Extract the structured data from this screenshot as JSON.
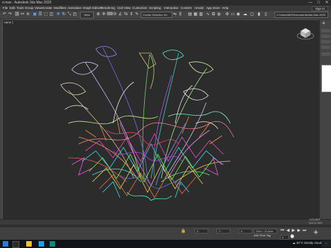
{
  "window": {
    "title": "ıt.max - Autodesk 3ds Max 2020",
    "controls": [
      "—",
      "□",
      "✕"
    ]
  },
  "menu": {
    "items": [
      "File",
      "Edit",
      "Tools",
      "Group",
      "Views",
      "Create",
      "Modifiers",
      "Animation",
      "Graph Editors",
      "Rendering",
      "Civil View",
      "Customize",
      "Scripting",
      "Interactive",
      "Content",
      "Arnold",
      "App Store",
      "Help"
    ],
    "sign_in": "Sign In"
  },
  "toolbar": {
    "view_dropdown": "View",
    "selection_set": "Create Selection Se",
    "path": "C:\\Users\\WH\\Documents\\3ds Max 2020"
  },
  "viewport": {
    "label": "[+] [Perspective] [Standard] [Wireframe]",
    "shown_label": "rame ]"
  },
  "timeline": {
    "position": "0 / 100"
  },
  "status": {
    "x_field": "X:",
    "y_field": "Y:",
    "z_field": "Z:",
    "grid": "Grid = 10,0cm",
    "add_time_tag": "Add Time Tag",
    "auto_key": "Auto Key",
    "set_key": "Set Key",
    "frame": "0"
  },
  "activate_windows": {
    "line1": "Activate",
    "line2": "Go to Set"
  },
  "taskbar": {
    "weather_temp": "32°C",
    "weather_text": "Mostly cloudy"
  },
  "colors": {
    "viewport_bg": "#2c2c2c",
    "accent": "#5aa8ff"
  }
}
